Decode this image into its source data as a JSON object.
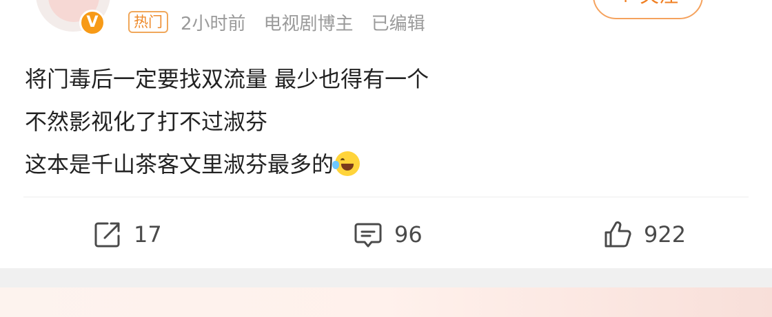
{
  "post": {
    "badge": "热门",
    "time": "2小时前",
    "author_title": "电视剧博主",
    "edited": "已编辑",
    "verified_mark": "V",
    "follow_label": "+ 关注",
    "lines": [
      "将门毒后一定要找双流量 最少也得有一个",
      "不然影视化了打不过淑芬",
      "这本是千山茶客文里淑芬最多的"
    ],
    "inline_emoji": "laughing-crying-emoji"
  },
  "actions": {
    "repost_count": "17",
    "comment_count": "96",
    "like_count": "922"
  },
  "colors": {
    "accent_orange": "#f07f22",
    "badge_border": "#f0a75a",
    "meta_gray": "#9a9a9a",
    "text": "#222222",
    "verified": "#f79a17"
  },
  "icons": [
    "repost-icon",
    "comment-icon",
    "like-icon",
    "verified-icon"
  ]
}
